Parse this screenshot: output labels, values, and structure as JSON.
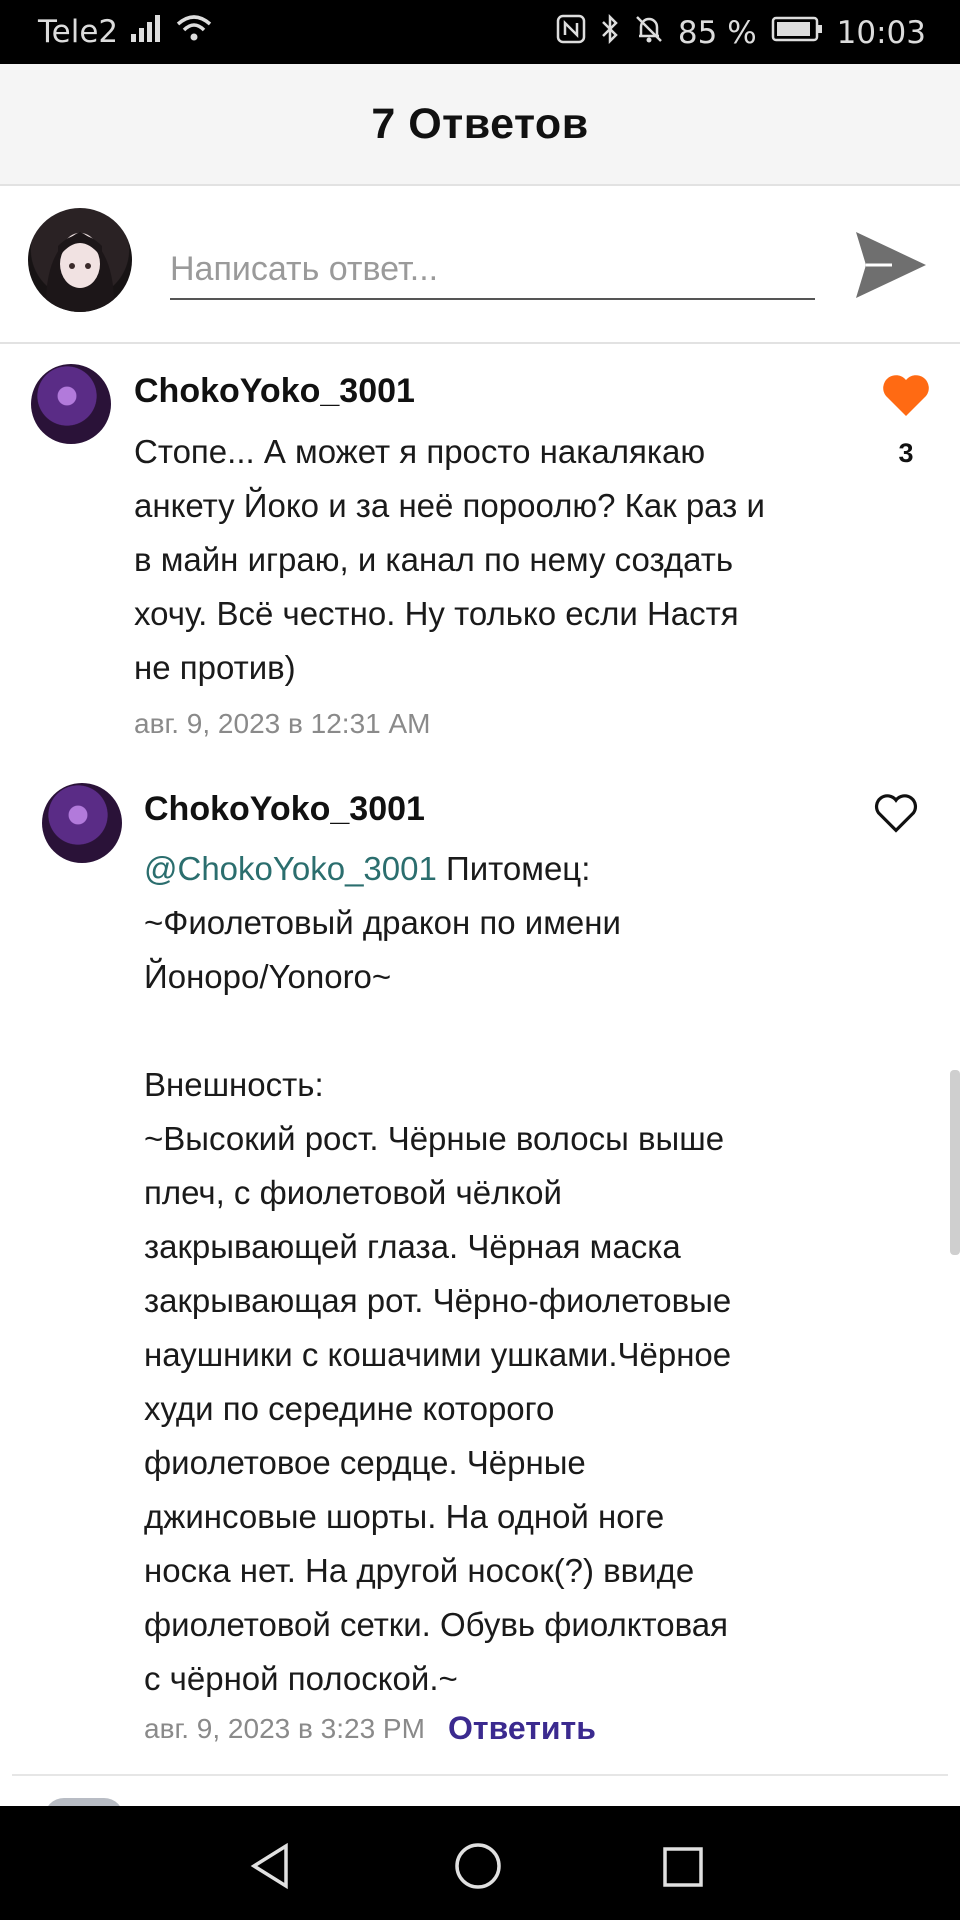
{
  "status_bar": {
    "carrier": "Tele2",
    "battery": "85 %",
    "time": "10:03",
    "icons": [
      "signal-icon",
      "wifi-icon",
      "nfc-icon",
      "bluetooth-icon",
      "mute-icon",
      "battery-icon"
    ]
  },
  "header": {
    "title": "7 Ответов"
  },
  "composer": {
    "placeholder": "Написать ответ...",
    "send_icon": "send-icon"
  },
  "comments": [
    {
      "username": "ChokoYoko_3001",
      "text": "Стопе... А может я просто накалякаю\nанкету Йоко и за неё пороолю? Как раз и\nв майн играю, и канал по нему создать\nхочу. Всё честно. Ну только если Настя\nне против)",
      "timestamp": "авг. 9, 2023 в 12:31 AM",
      "likes": "3",
      "liked": true
    },
    {
      "username": "ChokoYoko_3001",
      "mention": "@ChokoYoko_3001",
      "text_after_mention": " Питомец:\n~Фиолетовый дракон по имени\nЙоноро/Yonoro~\n\nВнешность:\n~Высокий рост. Чёрные волосы выше\nплеч, с фиолетовой чёлкой\nзакрывающей глаза. Чёрная маска\nзакрывающая рот. Чёрно-фиолетовые\nнаушники с кошачими ушками.Чёрное\nхуди по середине которого\nфиолетовое сердце. Чёрные\nджинсовые шорты. На одной ноге\nноска нет. На другой носок(?) ввиде\nфиолетовой сетки. Обувь фиолктовая\nс чёрной полоской.~",
      "timestamp": "авг. 9, 2023 в 3:23 PM",
      "reply_label": "Ответить",
      "liked": false
    }
  ],
  "colors": {
    "like_active": "#ff6a13",
    "reply_link": "#3b2a8f",
    "mention": "#2b6e6e"
  }
}
